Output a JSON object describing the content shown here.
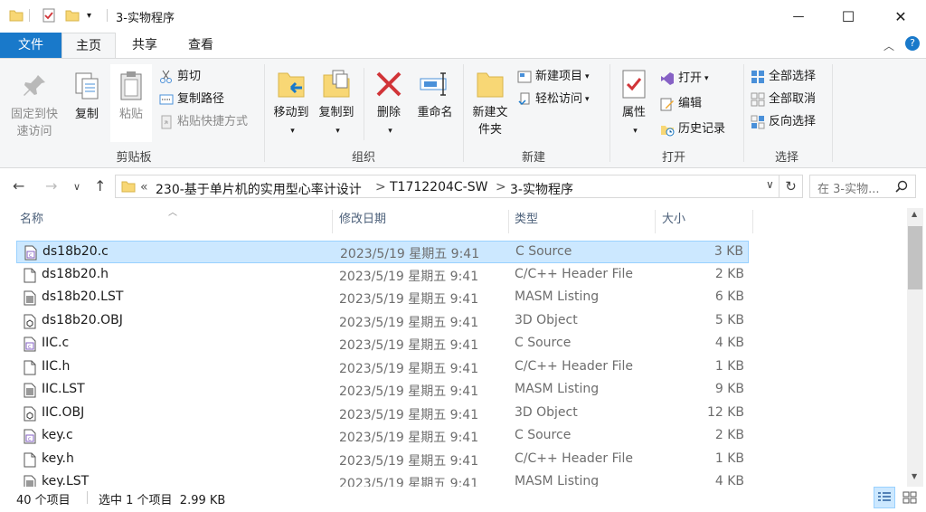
{
  "window": {
    "title": "3-实物程序",
    "minimize": "—",
    "maximize": "☐",
    "close": "✕"
  },
  "tabs": [
    "文件",
    "主页",
    "共享",
    "查看"
  ],
  "ribbon": {
    "clipboard": {
      "label": "剪贴板",
      "pin": "固定到快速访问",
      "copy": "复制",
      "paste": "粘贴",
      "cut": "剪切",
      "copy_path": "复制路径",
      "paste_shortcut": "粘贴快捷方式"
    },
    "organize": {
      "label": "组织",
      "move_to": "移动到",
      "copy_to": "复制到",
      "delete": "删除",
      "rename": "重命名"
    },
    "new": {
      "label": "新建",
      "new_folder": "新建文件夹",
      "new_item": "新建项目",
      "easy_access": "轻松访问"
    },
    "open": {
      "label": "打开",
      "properties": "属性",
      "open": "打开",
      "edit": "编辑",
      "history": "历史记录"
    },
    "select": {
      "label": "选择",
      "select_all": "全部选择",
      "select_none": "全部取消",
      "invert": "反向选择"
    }
  },
  "address": {
    "crumbs": [
      "«",
      "230-基于单片机的实用型心率计设计",
      ">",
      "T1712204C-SW",
      ">",
      "3-实物程序"
    ],
    "search_placeholder": "在 3-实物..."
  },
  "columns": [
    "名称",
    "修改日期",
    "类型",
    "大小"
  ],
  "files": [
    {
      "name": "ds18b20.c",
      "date": "2023/5/19 星期五 9:41",
      "type": "C Source",
      "size": "3 KB",
      "icon": "c-source-icon",
      "selected": true
    },
    {
      "name": "ds18b20.h",
      "date": "2023/5/19 星期五 9:41",
      "type": "C/C++ Header File",
      "size": "2 KB",
      "icon": "header-file-icon"
    },
    {
      "name": "ds18b20.LST",
      "date": "2023/5/19 星期五 9:41",
      "type": "MASM Listing",
      "size": "6 KB",
      "icon": "listing-file-icon"
    },
    {
      "name": "ds18b20.OBJ",
      "date": "2023/5/19 星期五 9:41",
      "type": "3D Object",
      "size": "5 KB",
      "icon": "object-file-icon"
    },
    {
      "name": "IIC.c",
      "date": "2023/5/19 星期五 9:41",
      "type": "C Source",
      "size": "4 KB",
      "icon": "c-source-icon"
    },
    {
      "name": "IIC.h",
      "date": "2023/5/19 星期五 9:41",
      "type": "C/C++ Header File",
      "size": "1 KB",
      "icon": "header-file-icon"
    },
    {
      "name": "IIC.LST",
      "date": "2023/5/19 星期五 9:41",
      "type": "MASM Listing",
      "size": "9 KB",
      "icon": "listing-file-icon"
    },
    {
      "name": "IIC.OBJ",
      "date": "2023/5/19 星期五 9:41",
      "type": "3D Object",
      "size": "12 KB",
      "icon": "object-file-icon"
    },
    {
      "name": "key.c",
      "date": "2023/5/19 星期五 9:41",
      "type": "C Source",
      "size": "2 KB",
      "icon": "c-source-icon"
    },
    {
      "name": "key.h",
      "date": "2023/5/19 星期五 9:41",
      "type": "C/C++ Header File",
      "size": "1 KB",
      "icon": "header-file-icon"
    },
    {
      "name": "key.LST",
      "date": "2023/5/19 星期五 9:41",
      "type": "MASM Listing",
      "size": "4 KB",
      "icon": "listing-file-icon"
    }
  ],
  "status": {
    "count": "40 个项目",
    "selection": "选中 1 个项目  2.99 KB"
  },
  "colors": {
    "accent": "#1979ca",
    "selection": "#cce8ff",
    "folder": "#f8d775"
  }
}
